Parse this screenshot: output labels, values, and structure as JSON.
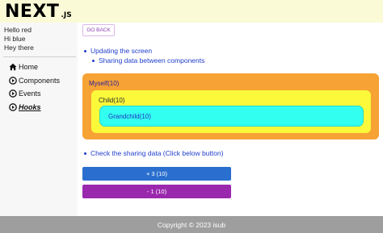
{
  "header": {
    "logo_main": "NEXT",
    "logo_sub": ".JS"
  },
  "sidebar": {
    "greetings": [
      "Hello red",
      "Hi blue",
      "Hey there"
    ],
    "nav": [
      {
        "label": "Home",
        "icon": "home-icon",
        "active": false
      },
      {
        "label": "Components",
        "icon": "circle-play-icon",
        "active": false
      },
      {
        "label": "Events",
        "icon": "circle-play-icon",
        "active": false
      },
      {
        "label": "Hooks",
        "icon": "circle-play-icon",
        "active": true
      }
    ]
  },
  "main": {
    "go_back": "GO BACK",
    "list1": {
      "item": "Updating the screen",
      "sub": "Sharing data between components"
    },
    "boxes": {
      "myself": "Myself(10)",
      "child": "Child(10)",
      "grandchild": "Grandchild(10)"
    },
    "list2": {
      "item": "Check the sharing data (Click below button)"
    },
    "buttons": {
      "increment": "+ 3 (10)",
      "decrement": "- 1 (10)"
    }
  },
  "footer": {
    "text": "Copyright © 2023 isub"
  },
  "colors": {
    "header_bg": "#fafad6",
    "myself_bg": "#f6a234",
    "child_bg": "#fbf93a",
    "grandchild_bg": "#33fff0",
    "increment_btn": "#2a6fcf",
    "decrement_btn": "#9a28ad",
    "footer_bg": "#9e9e9e",
    "link_text": "#1e3dcc"
  }
}
